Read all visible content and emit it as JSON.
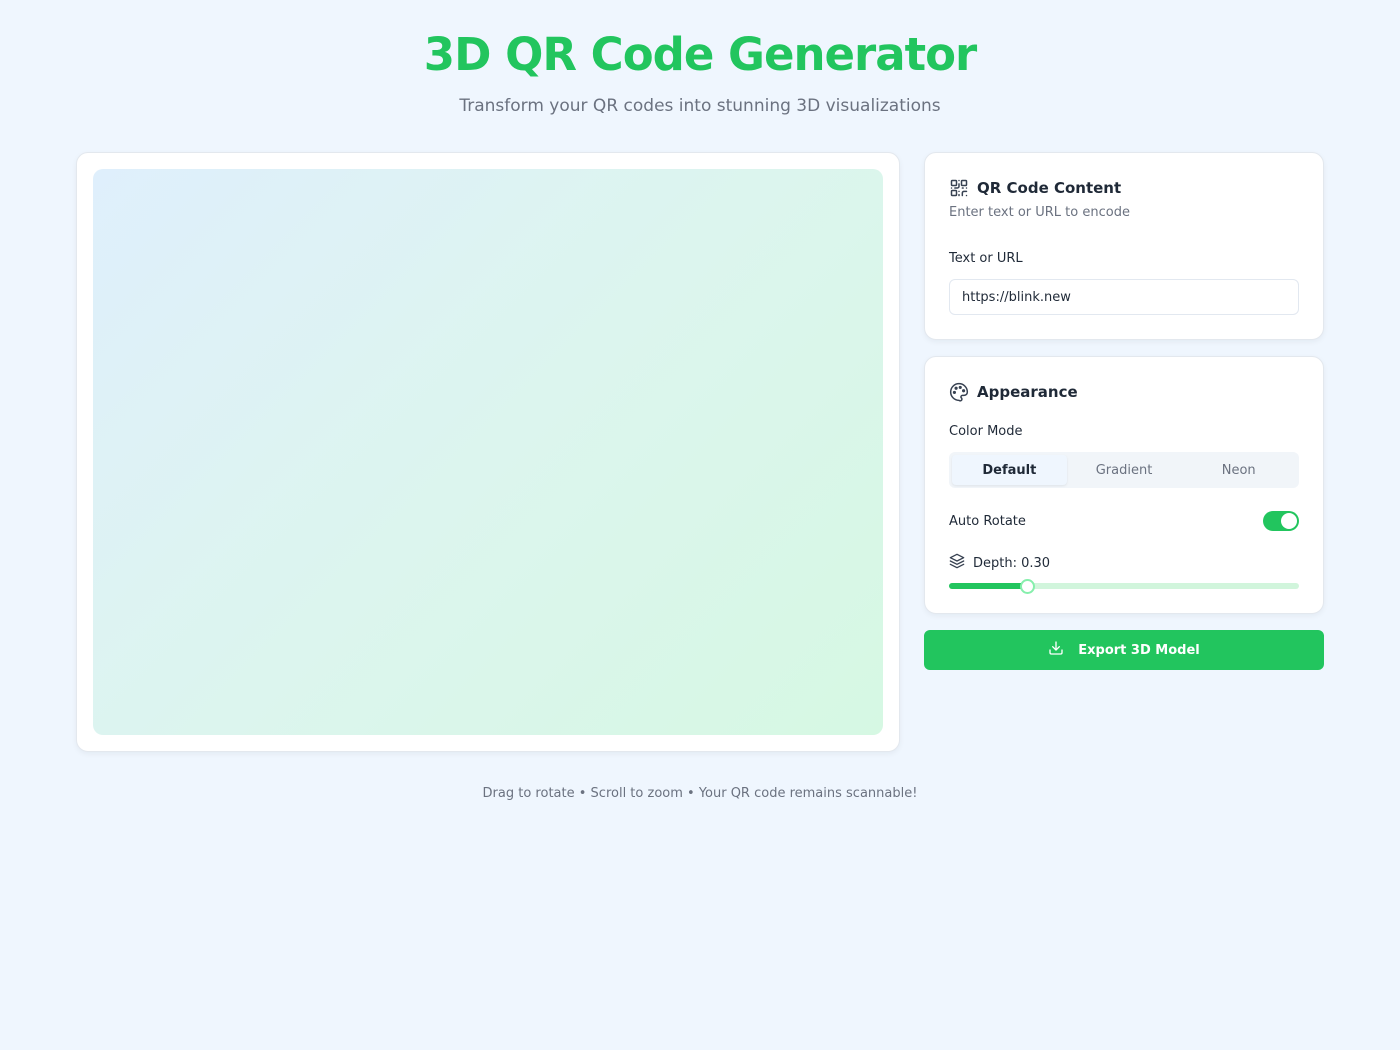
{
  "header": {
    "title": "3D QR Code Generator",
    "subtitle": "Transform your QR codes into stunning 3D visualizations"
  },
  "colors": {
    "accent": "#22c55e",
    "background": "#eff6fe",
    "card": "#ffffff",
    "muted_text": "#6b7280"
  },
  "qr_content": {
    "icon": "qr-code-icon",
    "title": "QR Code Content",
    "description": "Enter text or URL to encode",
    "input_label": "Text or URL",
    "input_value": "https://blink.new"
  },
  "appearance": {
    "icon": "palette-icon",
    "title": "Appearance",
    "color_mode_label": "Color Mode",
    "color_modes": [
      "Default",
      "Gradient",
      "Neon"
    ],
    "selected_color_mode": "Default",
    "auto_rotate_label": "Auto Rotate",
    "auto_rotate_on": true,
    "depth_icon": "layers-icon",
    "depth_label": "Depth: 0.30",
    "depth_value": 0.3,
    "depth_min": 0.1,
    "depth_max": 1.0
  },
  "export": {
    "icon": "download-icon",
    "label": "Export 3D Model"
  },
  "footer": {
    "hint": "Drag to rotate • Scroll to zoom • Your QR code remains scannable!"
  }
}
